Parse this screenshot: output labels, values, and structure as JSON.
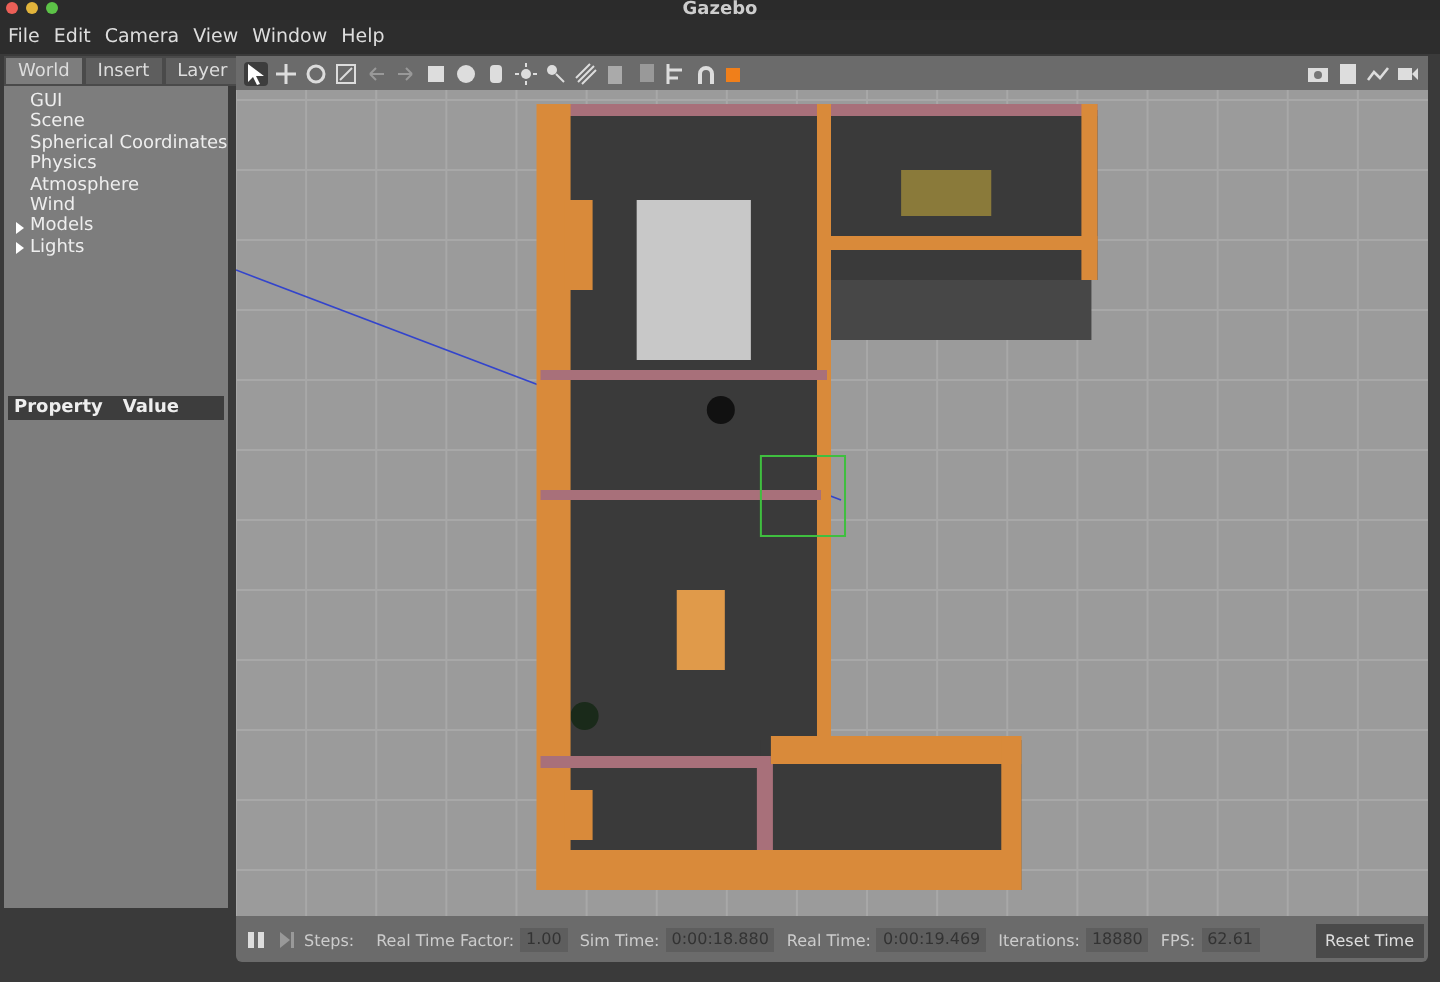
{
  "window": {
    "title": "Gazebo"
  },
  "menu": [
    "File",
    "Edit",
    "Camera",
    "View",
    "Window",
    "Help"
  ],
  "tabs": [
    {
      "label": "World",
      "selected": true
    },
    {
      "label": "Insert",
      "selected": false
    },
    {
      "label": "Layer",
      "selected": false
    }
  ],
  "tree": [
    {
      "label": "GUI",
      "kind": "leaf"
    },
    {
      "label": "Scene",
      "kind": "leaf"
    },
    {
      "label": "Spherical Coordinates",
      "kind": "leaf"
    },
    {
      "label": "Physics",
      "kind": "leaf"
    },
    {
      "label": "Atmosphere",
      "kind": "leaf"
    },
    {
      "label": "Wind",
      "kind": "leaf"
    },
    {
      "label": "Models",
      "kind": "group",
      "expanded": false
    },
    {
      "label": "Lights",
      "kind": "group",
      "expanded": false
    }
  ],
  "properties": {
    "columns": [
      "Property",
      "Value"
    ]
  },
  "status_bar": {
    "paused": false,
    "steps_label": "Steps:",
    "fields": [
      {
        "label": "Real Time Factor:",
        "value": "1.00"
      },
      {
        "label": "Sim Time:",
        "value": "0:00:18.880"
      },
      {
        "label": "Real Time:",
        "value": "0:00:19.469"
      },
      {
        "label": "Iterations:",
        "value": "18880"
      },
      {
        "label": "FPS:",
        "value": "62.61"
      }
    ],
    "reset_button": "Reset Time"
  }
}
